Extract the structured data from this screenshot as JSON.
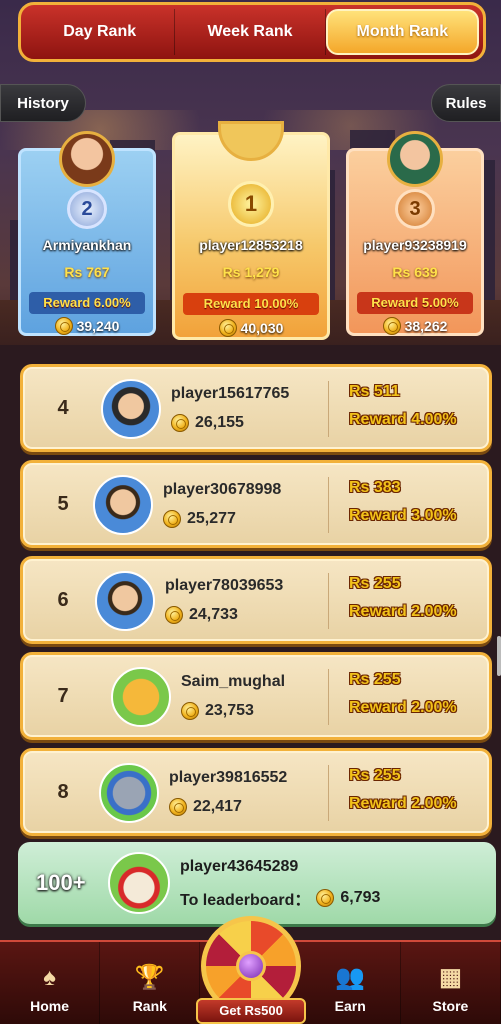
{
  "tabs": [
    {
      "label": "Day Rank",
      "active": false
    },
    {
      "label": "Week Rank",
      "active": false
    },
    {
      "label": "Month Rank",
      "active": true
    }
  ],
  "history_label": "History",
  "rules_label": "Rules",
  "podium": [
    {
      "rank": "2",
      "name": "Armiyankhan",
      "amount": "Rs 767",
      "reward": "Reward 6.00%",
      "coins": "39,240"
    },
    {
      "rank": "1",
      "name": "player12853218",
      "amount": "Rs 1,279",
      "reward": "Reward 10.00%",
      "coins": "40,030"
    },
    {
      "rank": "3",
      "name": "player93238919",
      "amount": "Rs 639",
      "reward": "Reward 5.00%",
      "coins": "38,262"
    }
  ],
  "rows": [
    {
      "rank": "4",
      "name": "player15617765",
      "coins": "26,155",
      "amount": "Rs 511",
      "reward": "Reward 4.00%"
    },
    {
      "rank": "5",
      "name": "player30678998",
      "coins": "25,277",
      "amount": "Rs 383",
      "reward": "Reward 3.00%"
    },
    {
      "rank": "6",
      "name": "player78039653",
      "coins": "24,733",
      "amount": "Rs 255",
      "reward": "Reward 2.00%"
    },
    {
      "rank": "7",
      "name": "Saim_mughal",
      "coins": "23,753",
      "amount": "Rs 255",
      "reward": "Reward 2.00%"
    },
    {
      "rank": "8",
      "name": "player39816552",
      "coins": "22,417",
      "amount": "Rs 255",
      "reward": "Reward 2.00%"
    }
  ],
  "me": {
    "rank": "100+",
    "name": "player43645289",
    "label": "To leaderboard：",
    "coins": "6,793"
  },
  "nav": [
    {
      "label": "Home",
      "icon": "spade-icon"
    },
    {
      "label": "Rank",
      "icon": "trophy-icon"
    },
    {
      "label": "Earn",
      "icon": "people-icon"
    },
    {
      "label": "Store",
      "icon": "store-icon"
    }
  ],
  "wheel_label": "Get Rs500"
}
